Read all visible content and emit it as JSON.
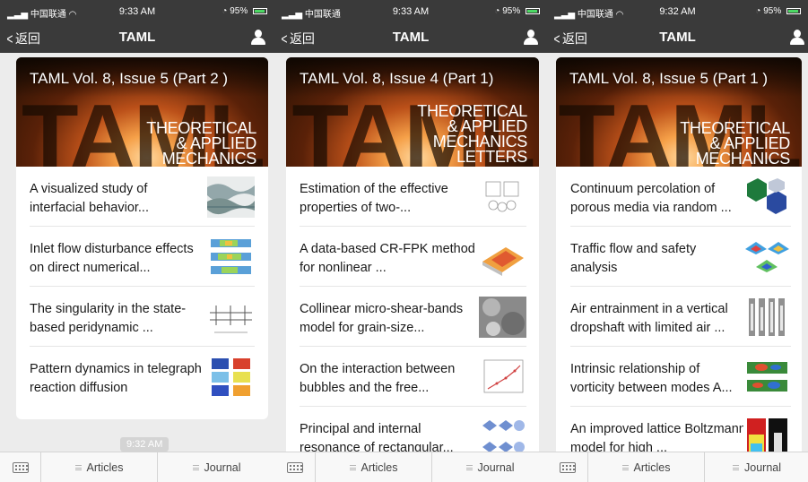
{
  "screens": [
    {
      "status": {
        "carrier": "中国联通",
        "time": "9:33 AM",
        "battery": "95%"
      },
      "nav": {
        "back_label": "返回",
        "title": "TAML"
      },
      "issue_title": "TAML Vol. 8, Issue 5 (Part 2 )",
      "journal_lines": [
        "THEORETICAL",
        "& APPLIED",
        "MECHANICS"
      ],
      "articles": [
        {
          "title": "A visualized study of interfacial behavior..."
        },
        {
          "title": "Inlet flow disturbance effects on direct numerical..."
        },
        {
          "title": "The singularity in the state-based peridynamic ..."
        },
        {
          "title": "Pattern dynamics in telegraph reaction diffusion"
        }
      ],
      "timestamp": "9:32 AM",
      "tabs": [
        "Articles",
        "Journal"
      ]
    },
    {
      "status": {
        "carrier": "中国联通",
        "time": "9:33 AM",
        "battery": "95%"
      },
      "nav": {
        "back_label": "返回",
        "title": "TAML"
      },
      "issue_title": "TAML Vol. 8, Issue 4 (Part 1)",
      "journal_lines": [
        "THEORETICAL",
        "& APPLIED",
        "MECHANICS",
        "LETTERS"
      ],
      "articles": [
        {
          "title": "Estimation of the effective properties of two-..."
        },
        {
          "title": "A data-based CR-FPK method for nonlinear ..."
        },
        {
          "title": "Collinear micro-shear-bands model for grain-size..."
        },
        {
          "title": "On the interaction between bubbles and the free..."
        },
        {
          "title": "Principal and internal resonance of rectangular..."
        }
      ],
      "tabs": [
        "Articles",
        "Journal"
      ]
    },
    {
      "status": {
        "carrier": "中国联通",
        "time": "9:32 AM",
        "battery": "95%"
      },
      "nav": {
        "back_label": "返回",
        "title": "TAML"
      },
      "issue_title": "TAML Vol. 8, Issue 5 (Part 1 )",
      "journal_lines": [
        "THEORETICAL",
        "& APPLIED",
        "MECHANICS"
      ],
      "articles": [
        {
          "title": "Continuum percolation of porous media via random ..."
        },
        {
          "title": "Traffic flow and safety analysis"
        },
        {
          "title": "Air entrainment in a vertical dropshaft with limited air ..."
        },
        {
          "title": "Intrinsic relationship of vorticity between modes A..."
        },
        {
          "title": "An improved lattice Boltzmann model for high ..."
        }
      ],
      "tabs": [
        "Articles",
        "Journal"
      ]
    }
  ],
  "colors": {
    "nav_bg": "#3a3a3a",
    "page_bg": "#ececec",
    "battery": "#4cd964"
  },
  "icons": [
    "signal-icon",
    "wifi-icon",
    "alarm-icon",
    "battery-icon",
    "back-chevron-icon",
    "person-icon",
    "keyboard-icon",
    "menu-icon"
  ]
}
